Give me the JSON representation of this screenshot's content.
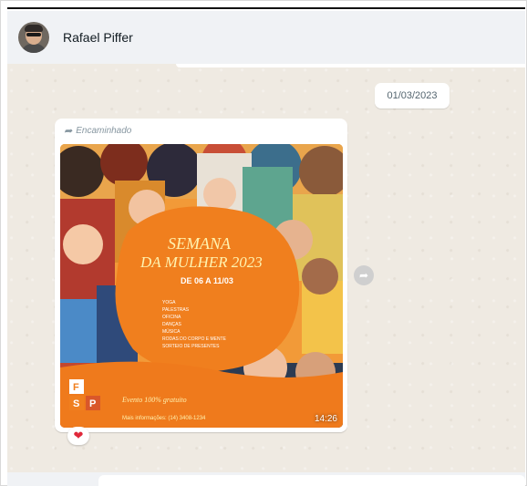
{
  "header": {
    "contact_name": "Rafael Piffer"
  },
  "chat": {
    "date_chip": "01/03/2023",
    "message": {
      "forwarded_label": "Encaminhado",
      "time": "14:26",
      "reaction": "❤",
      "image": {
        "title_line1": "SEMANA",
        "title_line2": "DA MULHER 2023",
        "dates": "DE 06 A 11/03",
        "items": [
          "YOGA",
          "PALESTRAS",
          "OFICINA",
          "DANÇAS",
          "MÚSICA",
          "RODAS DO CORPO E MENTE",
          "SORTEIO DE PRESENTES"
        ],
        "free_event": "Evento 100% gratuito",
        "info": "Mais informações: (14) 3408-1234",
        "logo_letters": [
          "F",
          "S",
          "P"
        ]
      }
    }
  },
  "colors": {
    "chat_bg": "#efeae2",
    "header_bg": "#f0f2f5",
    "accent": "#e0283a"
  }
}
